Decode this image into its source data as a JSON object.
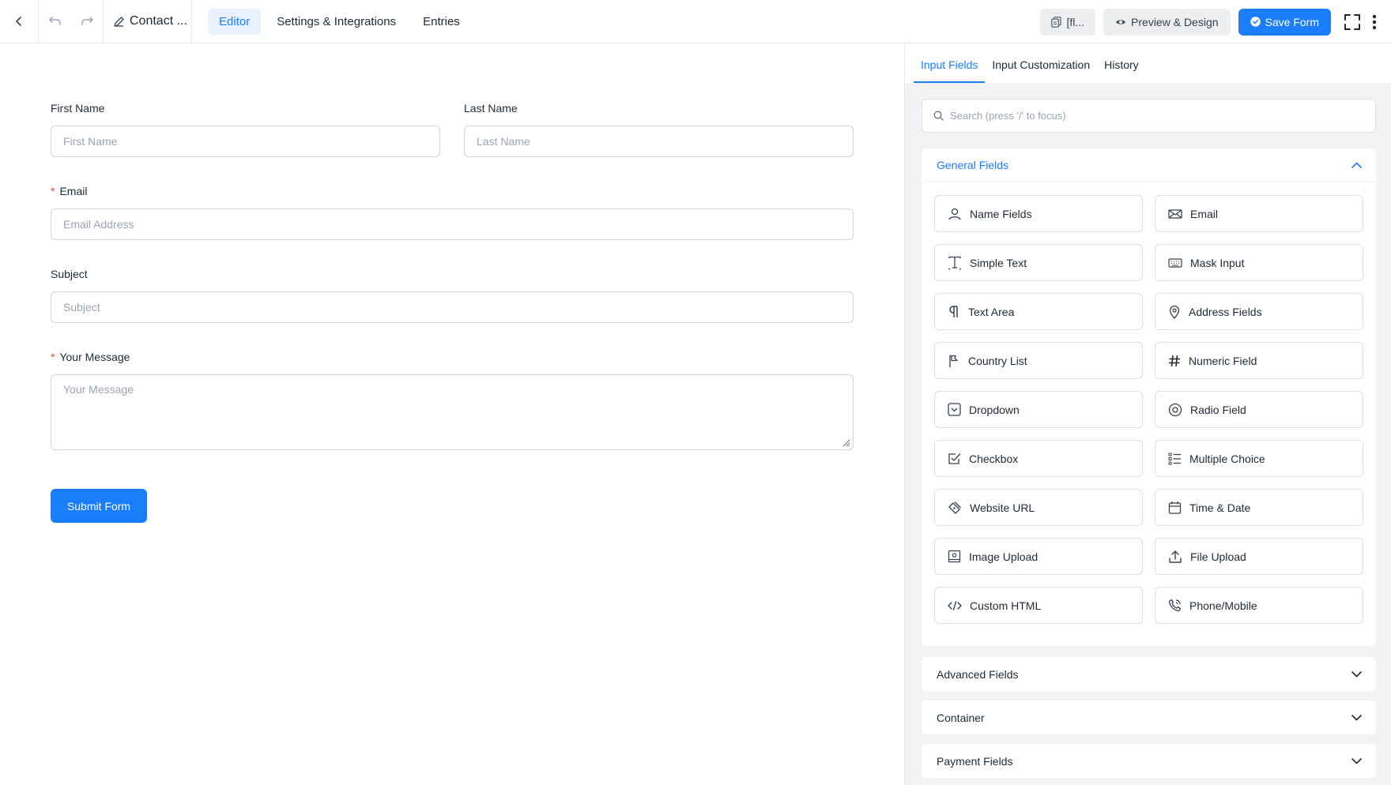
{
  "topbar": {
    "form_title": "Contact ...",
    "tabs": [
      {
        "label": "Editor"
      },
      {
        "label": "Settings & Integrations"
      },
      {
        "label": "Entries"
      }
    ],
    "shortcode_label": "[fl...",
    "preview_label": "Preview & Design",
    "save_label": "Save Form"
  },
  "form": {
    "first_name": {
      "label": "First Name",
      "placeholder": "First Name"
    },
    "last_name": {
      "label": "Last Name",
      "placeholder": "Last Name"
    },
    "email": {
      "required_mark": "*",
      "label": "Email",
      "placeholder": "Email Address"
    },
    "subject": {
      "label": "Subject",
      "placeholder": "Subject"
    },
    "message": {
      "required_mark": "*",
      "label": "Your Message",
      "placeholder": "Your Message"
    },
    "submit_label": "Submit Form"
  },
  "panel": {
    "tabs": [
      {
        "label": "Input Fields"
      },
      {
        "label": "Input Customization"
      },
      {
        "label": "History"
      }
    ],
    "search_placeholder": "Search (press '/' to focus)",
    "general": {
      "title": "General Fields",
      "fields": [
        {
          "label": "Name Fields",
          "icon": "user-icon"
        },
        {
          "label": "Email",
          "icon": "envelope-icon"
        },
        {
          "label": "Simple Text",
          "icon": "text-cursor-icon"
        },
        {
          "label": "Mask Input",
          "icon": "keyboard-icon"
        },
        {
          "label": "Text Area",
          "icon": "paragraph-icon"
        },
        {
          "label": "Address Fields",
          "icon": "map-pin-icon"
        },
        {
          "label": "Country List",
          "icon": "flag-icon"
        },
        {
          "label": "Numeric Field",
          "icon": "hash-icon"
        },
        {
          "label": "Dropdown",
          "icon": "dropdown-icon"
        },
        {
          "label": "Radio Field",
          "icon": "radio-icon"
        },
        {
          "label": "Checkbox",
          "icon": "checkbox-icon"
        },
        {
          "label": "Multiple Choice",
          "icon": "list-icon"
        },
        {
          "label": "Website URL",
          "icon": "link-icon"
        },
        {
          "label": "Time & Date",
          "icon": "calendar-icon"
        },
        {
          "label": "Image Upload",
          "icon": "image-icon"
        },
        {
          "label": "File Upload",
          "icon": "upload-icon"
        },
        {
          "label": "Custom HTML",
          "icon": "code-icon"
        },
        {
          "label": "Phone/Mobile",
          "icon": "phone-icon"
        }
      ]
    },
    "collapsed_groups": [
      {
        "title": "Advanced Fields"
      },
      {
        "title": "Container"
      },
      {
        "title": "Payment Fields"
      }
    ]
  },
  "colors": {
    "accent": "#1a7efb",
    "required": "#ef4444",
    "panel_bg": "#f2f3f5"
  }
}
